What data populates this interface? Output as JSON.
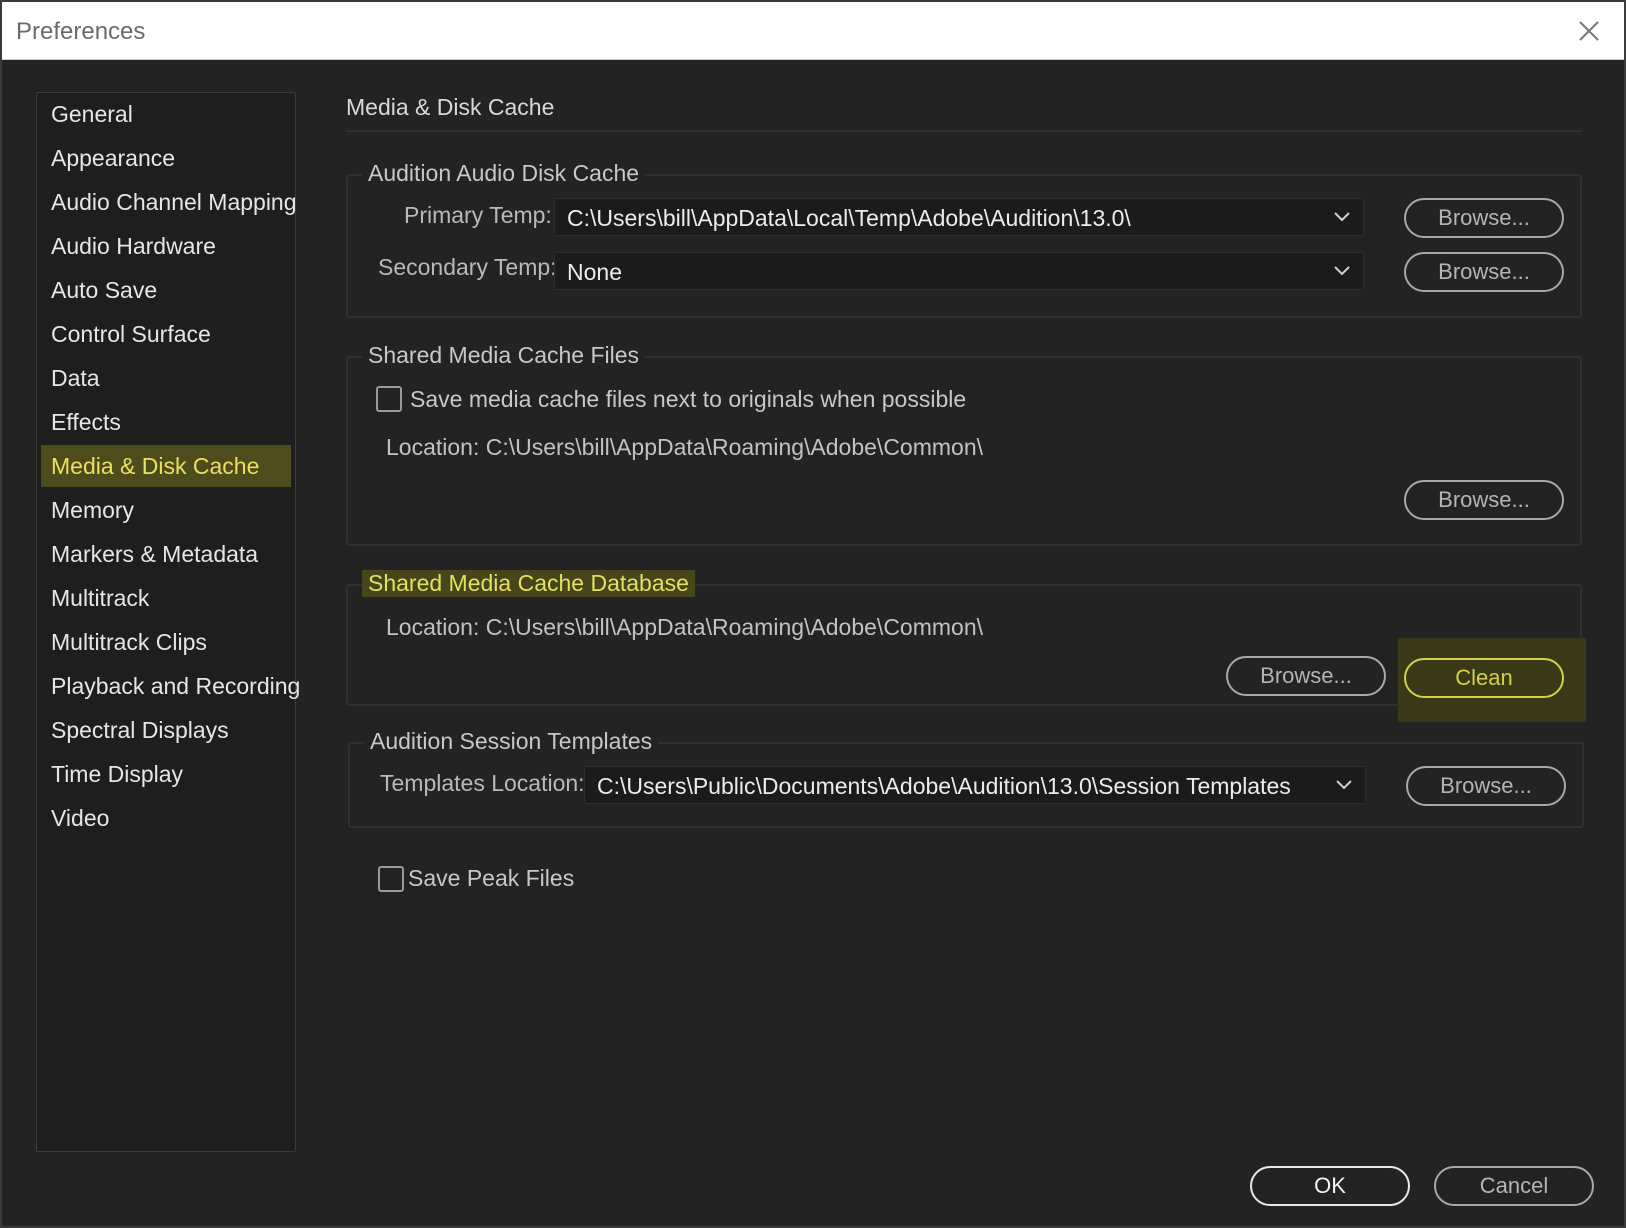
{
  "window": {
    "title": "Preferences"
  },
  "sidebar": {
    "items": [
      {
        "label": "General"
      },
      {
        "label": "Appearance"
      },
      {
        "label": "Audio Channel Mapping"
      },
      {
        "label": "Audio Hardware"
      },
      {
        "label": "Auto Save"
      },
      {
        "label": "Control Surface"
      },
      {
        "label": "Data"
      },
      {
        "label": "Effects"
      },
      {
        "label": "Media & Disk Cache",
        "selected": true
      },
      {
        "label": "Memory"
      },
      {
        "label": "Markers & Metadata"
      },
      {
        "label": "Multitrack"
      },
      {
        "label": "Multitrack Clips"
      },
      {
        "label": "Playback and Recording"
      },
      {
        "label": "Spectral Displays"
      },
      {
        "label": "Time Display"
      },
      {
        "label": "Video"
      }
    ]
  },
  "main": {
    "title": "Media & Disk Cache",
    "disk_cache": {
      "title": "Audition Audio Disk Cache",
      "primary_label": "Primary Temp:",
      "primary_value": "C:\\Users\\bill\\AppData\\Local\\Temp\\Adobe\\Audition\\13.0\\",
      "secondary_label": "Secondary Temp:",
      "secondary_value": "None",
      "browse_label": "Browse..."
    },
    "cache_files": {
      "title": "Shared Media Cache Files",
      "checkbox_label": "Save media cache files next to originals when possible",
      "checked": false,
      "location": "Location: C:\\Users\\bill\\AppData\\Roaming\\Adobe\\Common\\",
      "browse_label": "Browse..."
    },
    "cache_db": {
      "title": "Shared Media Cache Database",
      "location": "Location: C:\\Users\\bill\\AppData\\Roaming\\Adobe\\Common\\",
      "browse_label": "Browse...",
      "clean_label": "Clean"
    },
    "templates": {
      "title": "Audition Session Templates",
      "location_label": "Templates Location:",
      "location_value": "C:\\Users\\Public\\Documents\\Adobe\\Audition\\13.0\\Session Templates",
      "browse_label": "Browse..."
    },
    "peak_files": {
      "label": "Save Peak Files",
      "checked": false
    }
  },
  "footer": {
    "ok_label": "OK",
    "cancel_label": "Cancel"
  },
  "colors": {
    "background": "#232323",
    "highlight_bg": "#4e4c1c",
    "highlight_text": "#e8e060"
  }
}
